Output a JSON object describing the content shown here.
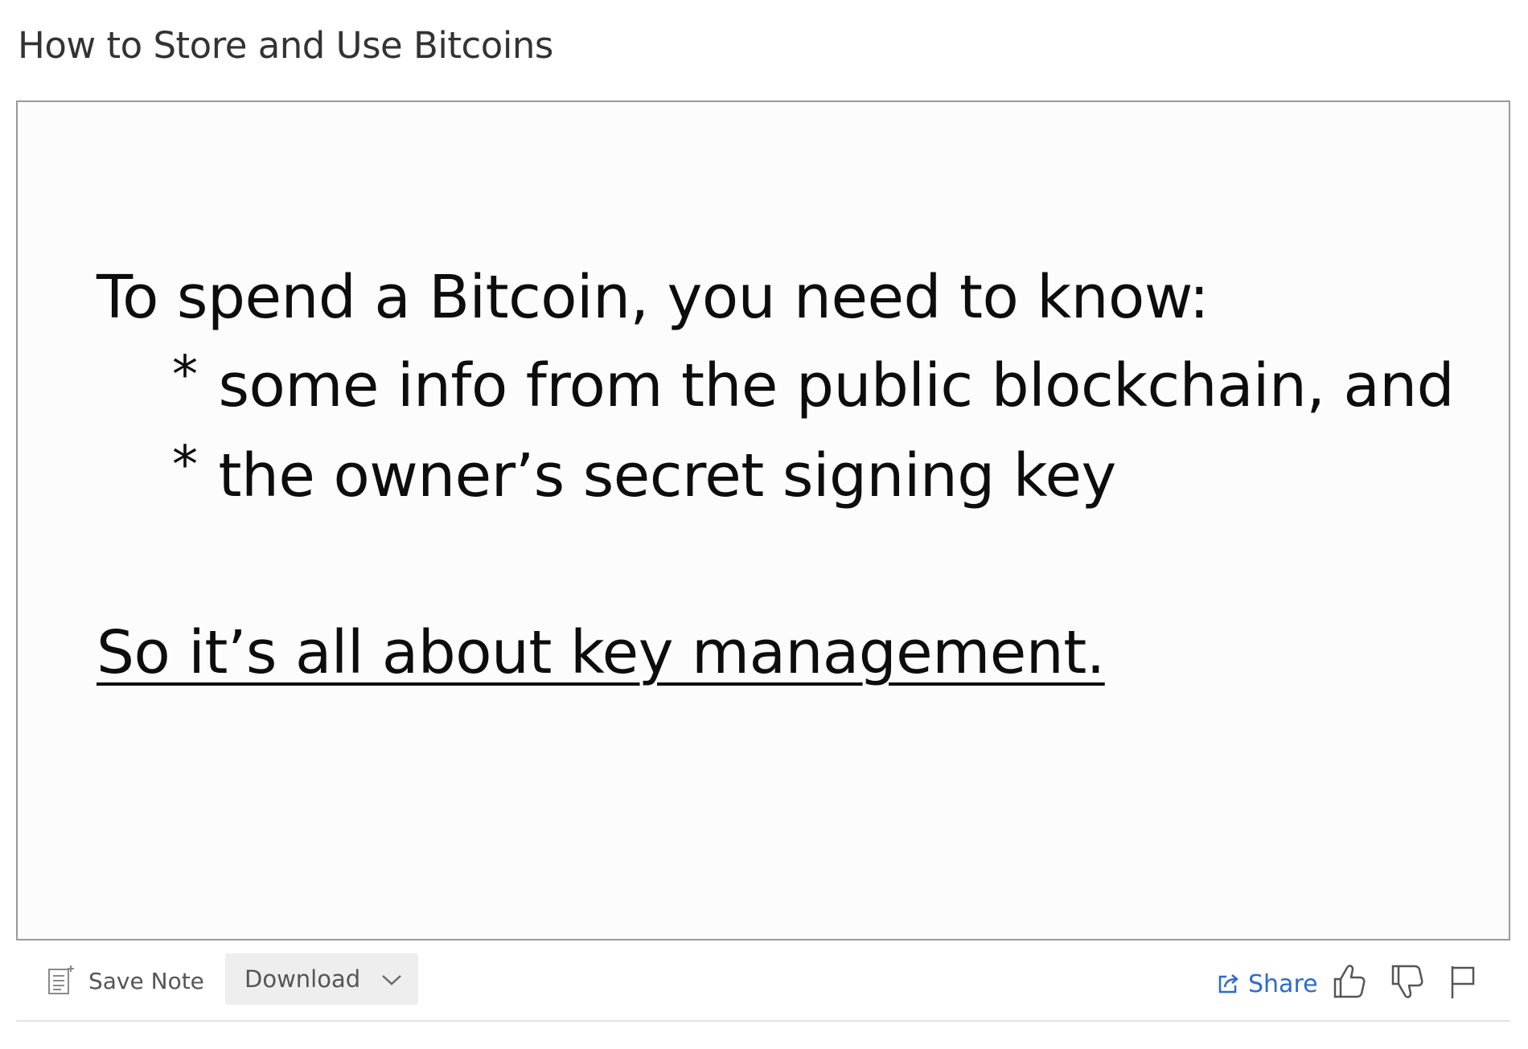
{
  "page": {
    "title": "How to Store and Use Bitcoins"
  },
  "slide": {
    "heading": "To spend a Bitcoin, you need to know:",
    "bullet_marker": "*",
    "bullets": [
      "some info from the public blockchain, and",
      "the owner’s secret signing key"
    ],
    "conclusion": "So it’s all about key management."
  },
  "toolbar": {
    "save_note_label": "Save Note",
    "save_note_icon": "note-icon",
    "download_label": "Download",
    "download_icon": "chevron-down-icon",
    "share_label": "Share",
    "share_icon": "share-icon",
    "like_icon": "thumbs-up-icon",
    "dislike_icon": "thumbs-down-icon",
    "flag_icon": "flag-icon"
  },
  "colors": {
    "share_link": "#2d6bcf",
    "slide_border": "#9a9a9a",
    "download_bg": "#eeeeee"
  }
}
